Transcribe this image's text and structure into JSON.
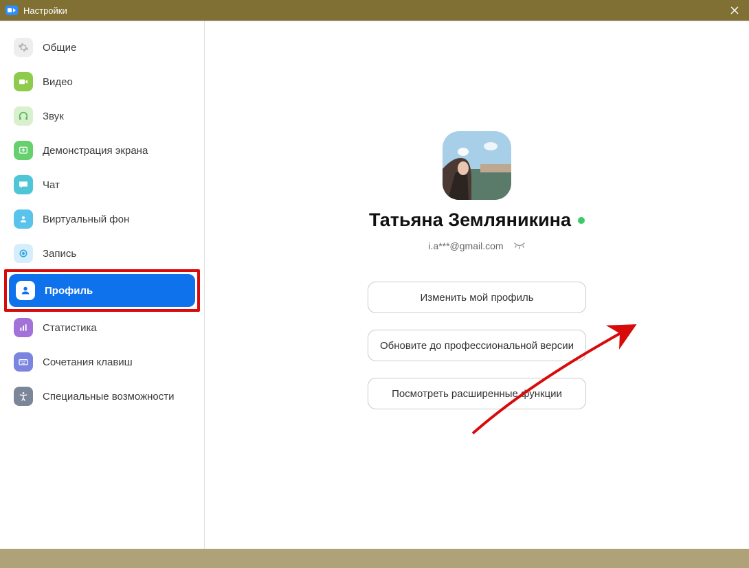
{
  "window": {
    "title": "Настройки"
  },
  "sidebar": {
    "items": [
      {
        "id": "general",
        "label": "Общие",
        "icon": "gear-icon",
        "iconBg": "#eeeeee",
        "iconFg": "#b8b8b8"
      },
      {
        "id": "video",
        "label": "Видео",
        "icon": "video-icon",
        "iconBg": "#8ecb4c",
        "iconFg": "#ffffff"
      },
      {
        "id": "audio",
        "label": "Звук",
        "icon": "headphones-icon",
        "iconBg": "#d9f0cf",
        "iconFg": "#54b851"
      },
      {
        "id": "screen-share",
        "label": "Демонстрация экрана",
        "icon": "share-screen-icon",
        "iconBg": "#66cf6e",
        "iconFg": "#ffffff"
      },
      {
        "id": "chat",
        "label": "Чат",
        "icon": "chat-icon",
        "iconBg": "#4fc6d6",
        "iconFg": "#ffffff"
      },
      {
        "id": "virtual-bg",
        "label": "Виртуальный фон",
        "icon": "virtual-bg-icon",
        "iconBg": "#5ac3ec",
        "iconFg": "#ffffff"
      },
      {
        "id": "recording",
        "label": "Запись",
        "icon": "record-icon",
        "iconBg": "#d6eefc",
        "iconFg": "#2da7e6"
      },
      {
        "id": "profile",
        "label": "Профиль",
        "icon": "person-icon",
        "iconBg": "#ffffff",
        "iconFg": "#0e72ed",
        "active": true,
        "highlight": true
      },
      {
        "id": "stats",
        "label": "Статистика",
        "icon": "stats-icon",
        "iconBg": "#a372d8",
        "iconFg": "#ffffff"
      },
      {
        "id": "shortcuts",
        "label": "Сочетания клавиш",
        "icon": "keyboard-icon",
        "iconBg": "#7b85e0",
        "iconFg": "#ffffff"
      },
      {
        "id": "accessibility",
        "label": "Специальные возможности",
        "icon": "accessibility-icon",
        "iconBg": "#7c8699",
        "iconFg": "#ffffff"
      }
    ]
  },
  "profile": {
    "name": "Татьяна Земляникина",
    "email": "i.a***@gmail.com",
    "status": "online",
    "buttons": {
      "edit": "Изменить мой профиль",
      "upgrade": "Обновите до профессиональной версии",
      "advanced": "Посмотреть расширенные функции"
    }
  },
  "colors": {
    "primary": "#0e72ed",
    "highlight": "#d80b0b",
    "titlebar": "#807034"
  }
}
